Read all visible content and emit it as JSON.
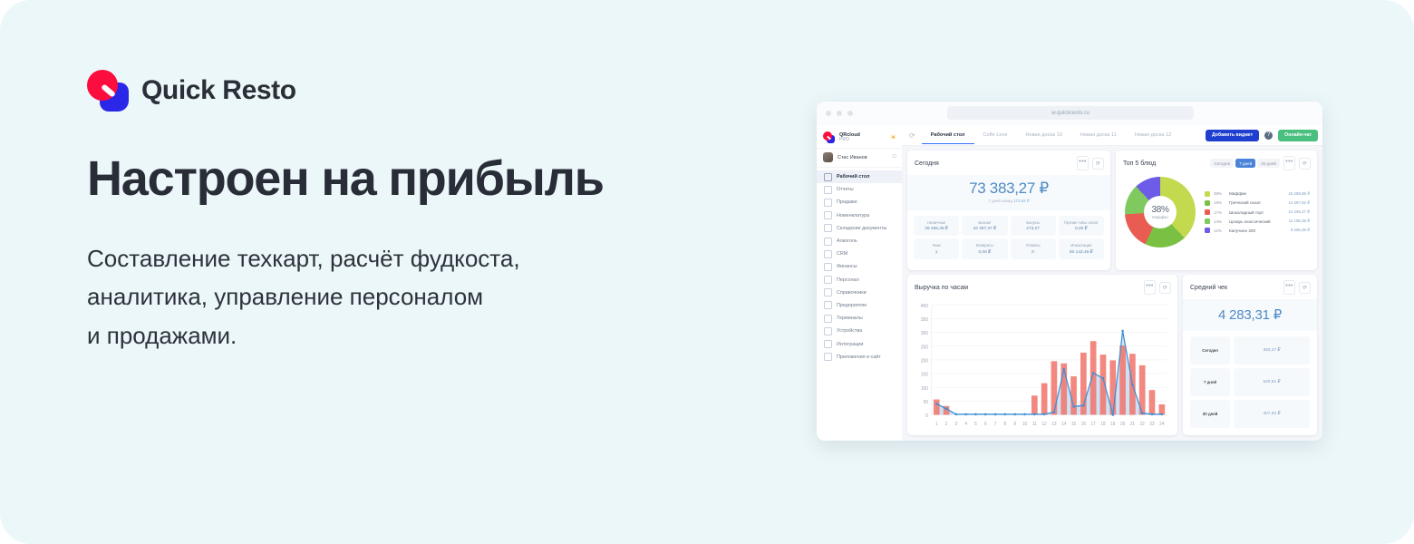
{
  "brand": {
    "name": "Quick Resto"
  },
  "hero": {
    "headline": "Настроен на прибыль",
    "subline_1": "Составление техкарт, расчёт фудкоста,",
    "subline_2": "аналитика, управление персоналом",
    "subline_3": "и продажами."
  },
  "browser": {
    "url": "w.quickresto.ru"
  },
  "sidebar": {
    "account": {
      "name": "QRcloud",
      "plan": "PRO"
    },
    "user": {
      "name": "Стас Иванов"
    },
    "items": [
      {
        "label": "Рабочий стол",
        "active": true
      },
      {
        "label": "Отчеты",
        "active": false
      },
      {
        "label": "Продажи",
        "active": false
      },
      {
        "label": "Номенклатура",
        "active": false
      },
      {
        "label": "Складские документы",
        "active": false
      },
      {
        "label": "Алкоголь",
        "active": false
      },
      {
        "label": "CRM",
        "active": false
      },
      {
        "label": "Финансы",
        "active": false
      },
      {
        "label": "Персонал",
        "active": false
      },
      {
        "label": "Справочники",
        "active": false
      },
      {
        "label": "Предприятие",
        "active": false
      },
      {
        "label": "Терминалы",
        "active": false
      },
      {
        "label": "Устройства",
        "active": false
      },
      {
        "label": "Интеграции",
        "active": false
      },
      {
        "label": "Приложения и сайт",
        "active": false
      }
    ]
  },
  "topbar": {
    "tabs": [
      {
        "label": "Рабочий стол",
        "active": true
      },
      {
        "label": "Coffe Love",
        "active": false
      },
      {
        "label": "Новая доска 10",
        "active": false
      },
      {
        "label": "Новая доска 11",
        "active": false
      },
      {
        "label": "Новая доска 12",
        "active": false
      }
    ],
    "add_widget_label": "Добавить виджет",
    "help_label": "?",
    "chat_label": "Онлайн-чат"
  },
  "today_card": {
    "title": "Сегодня",
    "amount": "73 383,27 ₽",
    "compare_prefix": "7 дней назад",
    "compare_value": "172,53 ₽",
    "tiles": [
      {
        "key": "Наличные",
        "value": "29 456,48 ₽"
      },
      {
        "key": "Безнал",
        "value": "43 397,37 ₽"
      },
      {
        "key": "Бонусы",
        "value": "273,27"
      },
      {
        "key": "Прочие типы оплат",
        "value": "0,00 ₽"
      },
      {
        "key": "Чеки",
        "value": "1"
      },
      {
        "key": "Возвраты",
        "value": "0,00 ₽"
      },
      {
        "key": "Отмены",
        "value": "0"
      },
      {
        "key": "Инкассация",
        "value": "50 142,46 ₽"
      }
    ]
  },
  "top5_card": {
    "title": "Топ 5 блюд",
    "periods": [
      {
        "label": "Сегодня",
        "active": false
      },
      {
        "label": "7 дней",
        "active": true
      },
      {
        "label": "30 дней",
        "active": false
      }
    ],
    "center_percent": "38%",
    "center_label": "Маффин",
    "chart_data": {
      "type": "pie",
      "title": "Топ 5 блюд",
      "categories": [
        "Маффин",
        "Греческий салат",
        "Шоколадный торт",
        "Цезарь классический",
        "Капучино 200"
      ],
      "values": [
        38,
        19,
        17,
        14,
        12
      ],
      "value_labels": [
        "15 286,86 ₽",
        "14 397,92 ₽",
        "12 296,27 ₽",
        "11 196,38 ₽",
        "9 266,38 ₽"
      ],
      "percent_labels": [
        "38%",
        "19%",
        "17%",
        "14%",
        "12%"
      ],
      "colors": [
        "#c3d94e",
        "#7ac143",
        "#e85c51",
        "#7fc95f",
        "#6c5ce7"
      ],
      "legend": "right"
    }
  },
  "hours_card": {
    "title": "Выручка по часам",
    "chart_data": {
      "type": "bar",
      "title": "Выручка по часам",
      "xlabel": "",
      "ylabel": "",
      "ylim": [
        0,
        400
      ],
      "yticks": [
        0,
        50,
        100,
        150,
        200,
        250,
        300,
        350,
        400
      ],
      "categories": [
        "1",
        "2",
        "3",
        "4",
        "5",
        "6",
        "7",
        "8",
        "9",
        "10",
        "11",
        "12",
        "13",
        "14",
        "15",
        "16",
        "17",
        "18",
        "19",
        "20",
        "21",
        "22",
        "23",
        "24"
      ],
      "series": [
        {
          "name": "Выручка",
          "type": "bar",
          "color": "#f0776e",
          "values": [
            56,
            32,
            0,
            0,
            0,
            0,
            0,
            0,
            0,
            0,
            70,
            115,
            195,
            187,
            140,
            226,
            268,
            219,
            198,
            252,
            222,
            180,
            90,
            38
          ]
        },
        {
          "name": "Чеки",
          "type": "line",
          "color": "#3d8fd6",
          "values": [
            40,
            22,
            2,
            2,
            2,
            2,
            2,
            2,
            2,
            2,
            2,
            2,
            10,
            166,
            30,
            34,
            152,
            133,
            0,
            305,
            110,
            6,
            2,
            2
          ]
        }
      ],
      "grid": true
    }
  },
  "avg_card": {
    "title": "Средний чек",
    "amount": "4 283,31 ₽",
    "rows": [
      {
        "key": "Сегодня",
        "value": "383,27 ₽"
      },
      {
        "key": "7 дней",
        "value": "520,81 ₽"
      },
      {
        "key": "30 дней",
        "value": "407,62 ₽"
      }
    ]
  },
  "icons": {
    "dots": "•••",
    "refresh": "⟳",
    "power": "⏻",
    "sun": "☀"
  }
}
